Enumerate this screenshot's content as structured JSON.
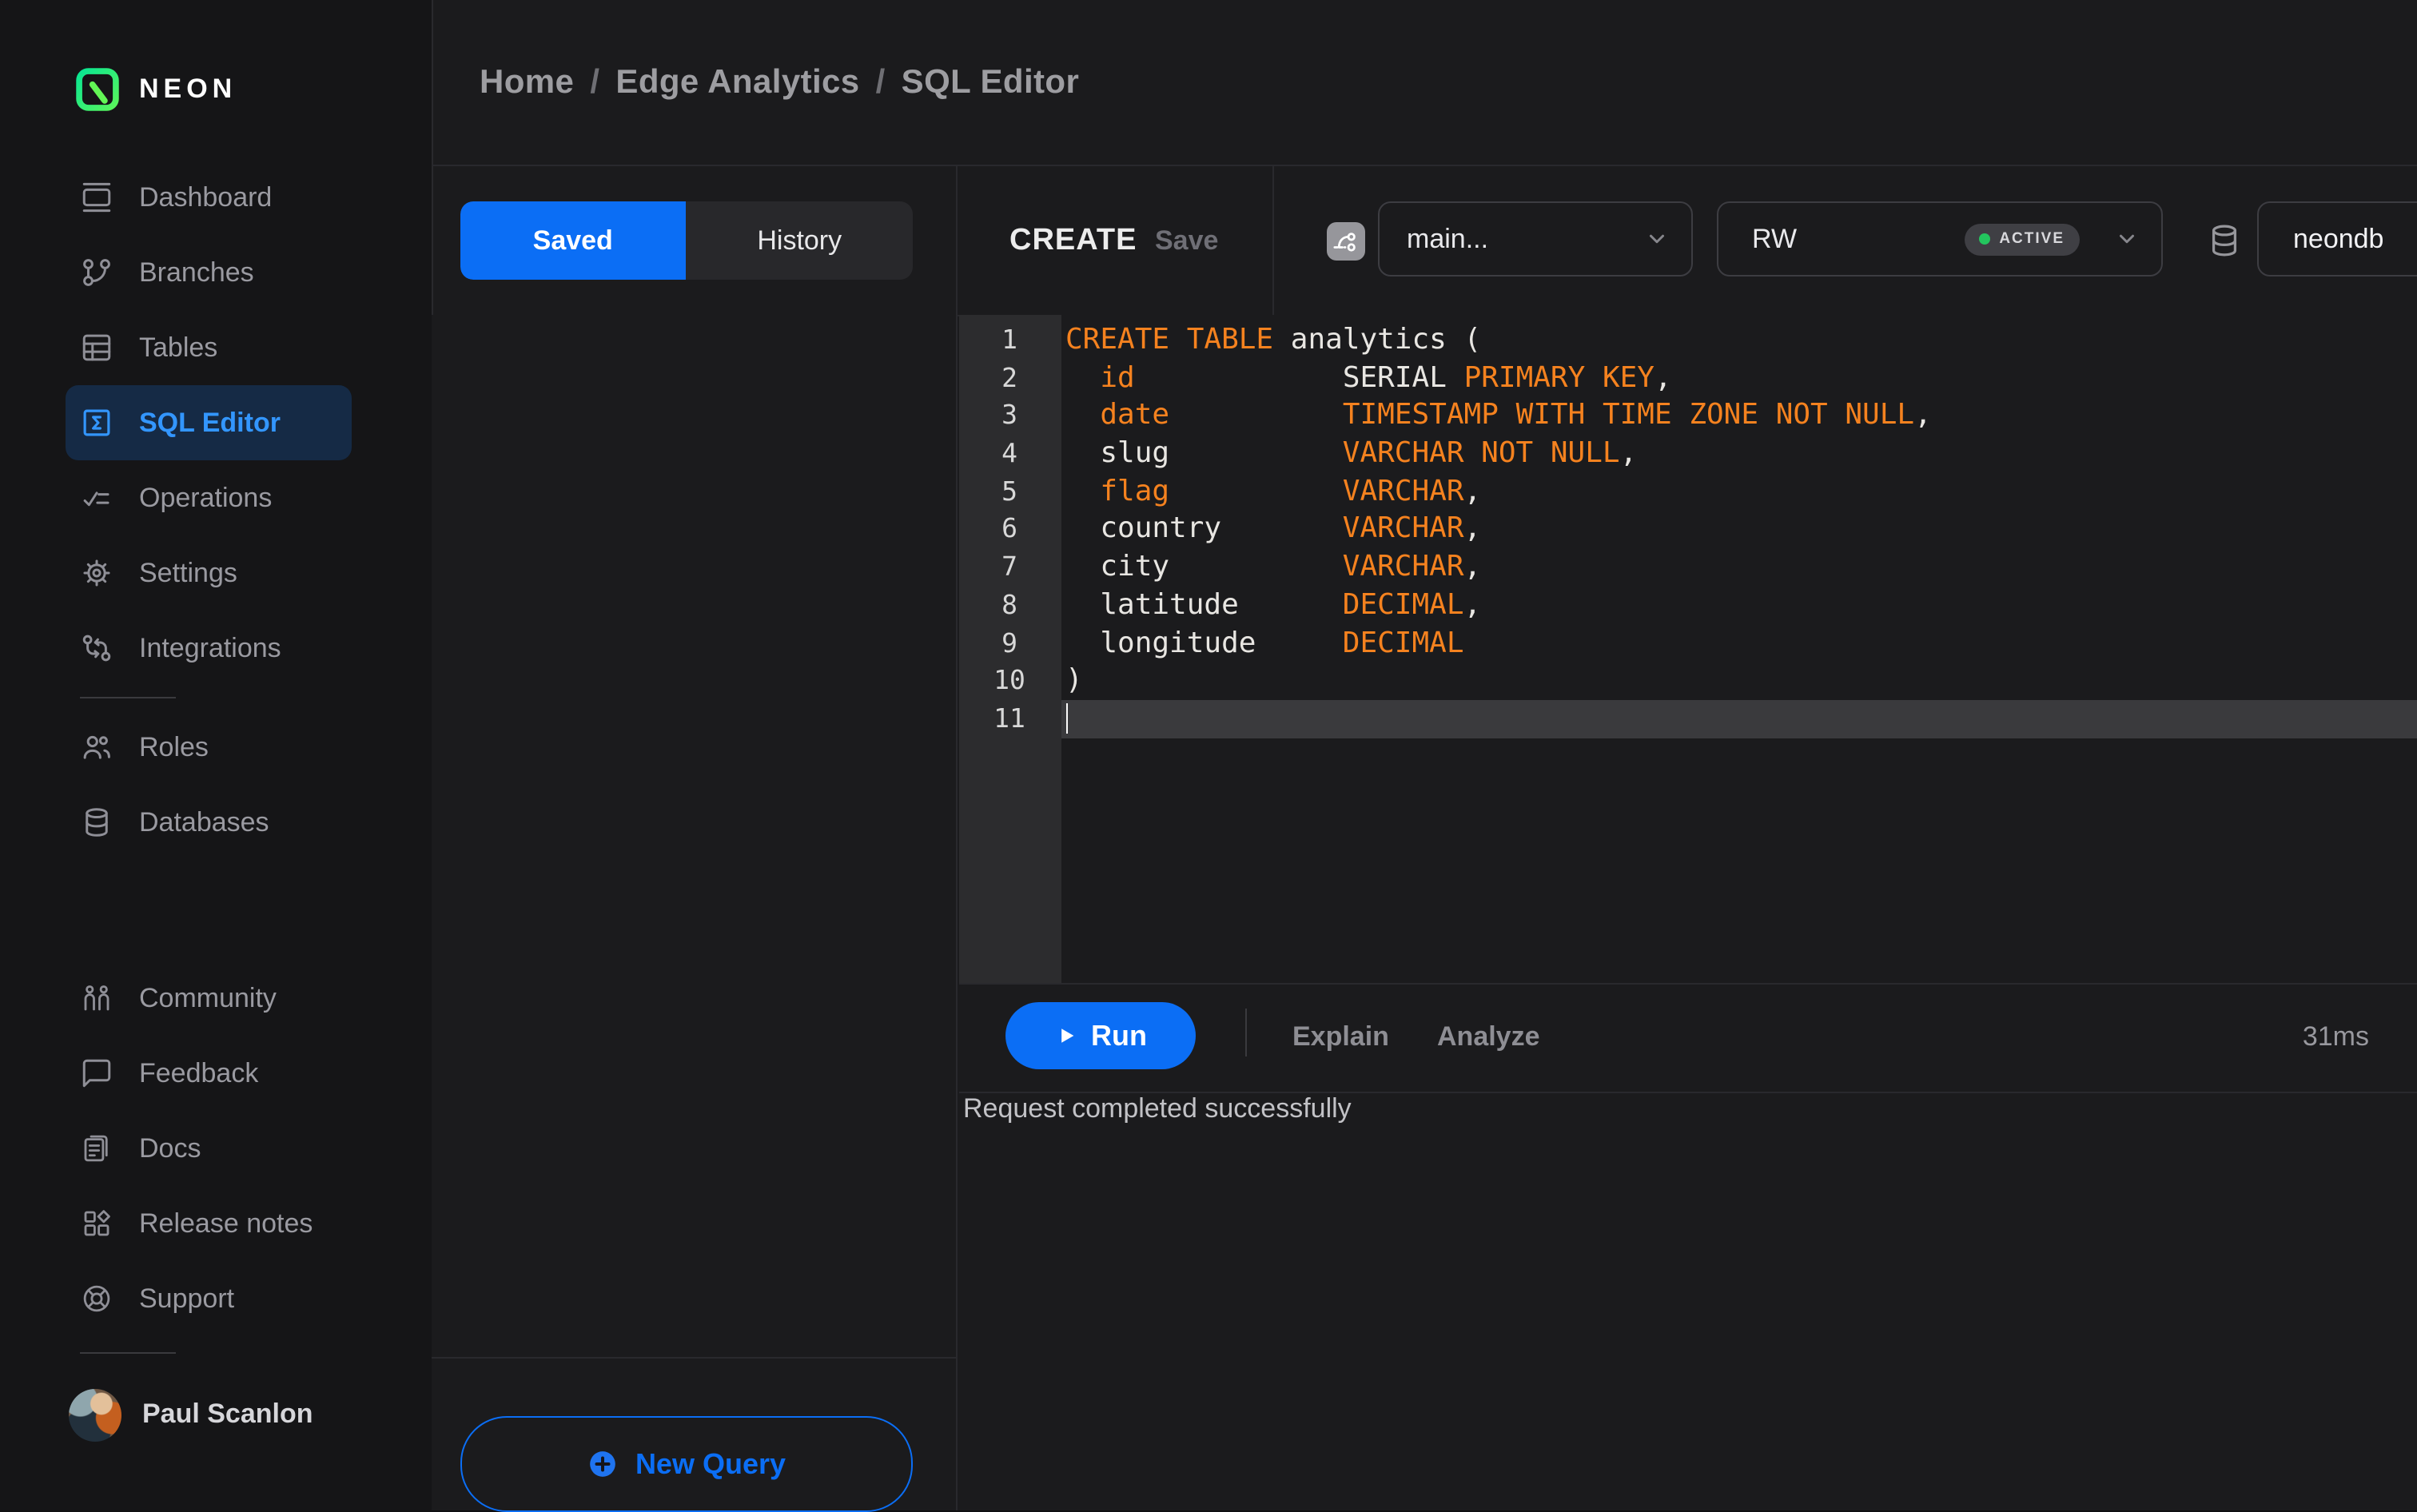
{
  "colors": {
    "accent": "#0b6ef5",
    "code-keyword": "#f5821f",
    "status-green": "#23c55e",
    "sidebar-active": "#3396fe"
  },
  "brand": {
    "name": "NEON"
  },
  "sidebar": {
    "sections": [
      {
        "items": [
          {
            "id": "dashboard",
            "label": "Dashboard",
            "active": false
          },
          {
            "id": "branches",
            "label": "Branches",
            "active": false
          },
          {
            "id": "tables",
            "label": "Tables",
            "active": false
          },
          {
            "id": "sql-editor",
            "label": "SQL Editor",
            "active": true
          },
          {
            "id": "operations",
            "label": "Operations",
            "active": false
          },
          {
            "id": "settings",
            "label": "Settings",
            "active": false
          },
          {
            "id": "integrations",
            "label": "Integrations",
            "active": false
          }
        ]
      },
      {
        "items": [
          {
            "id": "roles",
            "label": "Roles",
            "active": false
          },
          {
            "id": "databases",
            "label": "Databases",
            "active": false
          }
        ]
      },
      {
        "items": [
          {
            "id": "community",
            "label": "Community",
            "active": false
          },
          {
            "id": "feedback",
            "label": "Feedback",
            "active": false
          },
          {
            "id": "docs",
            "label": "Docs",
            "active": false
          },
          {
            "id": "release-notes",
            "label": "Release notes",
            "active": false
          },
          {
            "id": "support",
            "label": "Support",
            "active": false
          }
        ]
      }
    ],
    "user": {
      "name": "Paul Scanlon"
    }
  },
  "breadcrumb": {
    "separator": "/",
    "segments": [
      "Home",
      "Edge Analytics",
      "SQL Editor"
    ]
  },
  "query_panel": {
    "tabs": [
      {
        "label": "Saved",
        "active": true
      },
      {
        "label": "History",
        "active": false
      }
    ],
    "new_query_label": "New Query"
  },
  "editor": {
    "title": "CREATE",
    "save_label": "Save",
    "branch": {
      "value": "main..."
    },
    "compute": {
      "value": "RW",
      "status": "ACTIVE"
    },
    "database": {
      "value": "neondb"
    },
    "code": {
      "active_line": 11,
      "lines": [
        {
          "no": 1,
          "segments": [
            {
              "t": "CREATE TABLE",
              "c": "k"
            },
            {
              "t": " analytics (",
              "c": "p"
            }
          ]
        },
        {
          "no": 2,
          "segments": [
            {
              "t": "  ",
              "c": "p"
            },
            {
              "t": "id",
              "c": "k"
            },
            {
              "t": "            SERIAL ",
              "c": "p"
            },
            {
              "t": "PRIMARY KEY",
              "c": "k"
            },
            {
              "t": ",",
              "c": "p"
            }
          ]
        },
        {
          "no": 3,
          "segments": [
            {
              "t": "  ",
              "c": "p"
            },
            {
              "t": "date",
              "c": "k"
            },
            {
              "t": "          ",
              "c": "p"
            },
            {
              "t": "TIMESTAMP WITH TIME ZONE NOT NULL",
              "c": "k"
            },
            {
              "t": ",",
              "c": "p"
            }
          ]
        },
        {
          "no": 4,
          "segments": [
            {
              "t": "  slug          ",
              "c": "p"
            },
            {
              "t": "VARCHAR NOT NULL",
              "c": "k"
            },
            {
              "t": ",",
              "c": "p"
            }
          ]
        },
        {
          "no": 5,
          "segments": [
            {
              "t": "  ",
              "c": "p"
            },
            {
              "t": "flag",
              "c": "k"
            },
            {
              "t": "          ",
              "c": "p"
            },
            {
              "t": "VARCHAR",
              "c": "k"
            },
            {
              "t": ",",
              "c": "p"
            }
          ]
        },
        {
          "no": 6,
          "segments": [
            {
              "t": "  country       ",
              "c": "p"
            },
            {
              "t": "VARCHAR",
              "c": "k"
            },
            {
              "t": ",",
              "c": "p"
            }
          ]
        },
        {
          "no": 7,
          "segments": [
            {
              "t": "  city          ",
              "c": "p"
            },
            {
              "t": "VARCHAR",
              "c": "k"
            },
            {
              "t": ",",
              "c": "p"
            }
          ]
        },
        {
          "no": 8,
          "segments": [
            {
              "t": "  latitude      ",
              "c": "p"
            },
            {
              "t": "DECIMAL",
              "c": "k"
            },
            {
              "t": ",",
              "c": "p"
            }
          ]
        },
        {
          "no": 9,
          "segments": [
            {
              "t": "  longitude     ",
              "c": "p"
            },
            {
              "t": "DECIMAL",
              "c": "k"
            }
          ]
        },
        {
          "no": 10,
          "segments": [
            {
              "t": ")",
              "c": "p"
            }
          ]
        },
        {
          "no": 11,
          "segments": []
        }
      ]
    },
    "actions": {
      "run": "Run",
      "explain": "Explain",
      "analyze": "Analyze",
      "duration": "31ms"
    },
    "status_message": "Request completed successfully"
  }
}
